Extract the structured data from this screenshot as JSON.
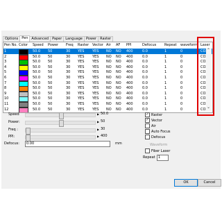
{
  "tabs": [
    "Options",
    "Pen",
    "Advanced",
    "Paper",
    "Language",
    "Power",
    "Raster"
  ],
  "table": {
    "columns": [
      "Pen No.",
      "Color",
      "Speed",
      "Power",
      "Freq",
      "Raster",
      "Vector",
      "Air",
      "AF",
      "PPI",
      "Defocus",
      "Repeat",
      "waveform",
      "Laser"
    ],
    "rows": [
      {
        "pen": "1",
        "color": "#000000",
        "speed": "50.0",
        "power": "50",
        "freq": "30",
        "raster": "YES",
        "vector": "YES",
        "air": "NO",
        "af": "NO",
        "ppi": "400",
        "defocus": "0.0",
        "repeat": "1",
        "waveform": "0",
        "laser": "CO2"
      },
      {
        "pen": "2",
        "color": "#ff0000",
        "speed": "50.0",
        "power": "50",
        "freq": "30",
        "raster": "YES",
        "vector": "YES",
        "air": "NO",
        "af": "NO",
        "ppi": "400",
        "defocus": "0.0",
        "repeat": "1",
        "waveform": "0",
        "laser": "CO2"
      },
      {
        "pen": "3",
        "color": "#00c000",
        "speed": "50.0",
        "power": "50",
        "freq": "30",
        "raster": "YES",
        "vector": "YES",
        "air": "NO",
        "af": "NO",
        "ppi": "400",
        "defocus": "0.0",
        "repeat": "1",
        "waveform": "0",
        "laser": "CO2"
      },
      {
        "pen": "4",
        "color": "#ffff00",
        "speed": "50.0",
        "power": "50",
        "freq": "30",
        "raster": "YES",
        "vector": "YES",
        "air": "NO",
        "af": "NO",
        "ppi": "400",
        "defocus": "0.0",
        "repeat": "1",
        "waveform": "0",
        "laser": "CO2"
      },
      {
        "pen": "5",
        "color": "#0000ff",
        "speed": "50.0",
        "power": "50",
        "freq": "30",
        "raster": "YES",
        "vector": "YES",
        "air": "NO",
        "af": "NO",
        "ppi": "400",
        "defocus": "0.0",
        "repeat": "1",
        "waveform": "0",
        "laser": "CO2"
      },
      {
        "pen": "6",
        "color": "#ff00ff",
        "speed": "50.0",
        "power": "50",
        "freq": "30",
        "raster": "YES",
        "vector": "YES",
        "air": "NO",
        "af": "NO",
        "ppi": "400",
        "defocus": "0.0",
        "repeat": "1",
        "waveform": "0",
        "laser": "CO2"
      },
      {
        "pen": "7",
        "color": "#00ffff",
        "speed": "50.0",
        "power": "50",
        "freq": "30",
        "raster": "YES",
        "vector": "YES",
        "air": "NO",
        "af": "NO",
        "ppi": "400",
        "defocus": "0.0",
        "repeat": "1",
        "waveform": "0",
        "laser": "CO2"
      },
      {
        "pen": "8",
        "color": "#ff8000",
        "speed": "50.0",
        "power": "50",
        "freq": "30",
        "raster": "YES",
        "vector": "YES",
        "air": "NO",
        "af": "NO",
        "ppi": "400",
        "defocus": "0.0",
        "repeat": "1",
        "waveform": "0",
        "laser": "CO2"
      },
      {
        "pen": "9",
        "color": "#c0c0c0",
        "speed": "50.0",
        "power": "50",
        "freq": "30",
        "raster": "YES",
        "vector": "YES",
        "air": "NO",
        "af": "NO",
        "ppi": "400",
        "defocus": "0.0",
        "repeat": "1",
        "waveform": "0",
        "laser": "CO2"
      },
      {
        "pen": "10",
        "color": "#80ffff",
        "speed": "50.0",
        "power": "50",
        "freq": "30",
        "raster": "YES",
        "vector": "YES",
        "air": "NO",
        "af": "NO",
        "ppi": "400",
        "defocus": "0.0",
        "repeat": "1",
        "waveform": "0",
        "laser": "CO2"
      },
      {
        "pen": "11",
        "color": "#808080",
        "speed": "50.0",
        "power": "50",
        "freq": "30",
        "raster": "YES",
        "vector": "YES",
        "air": "NO",
        "af": "NO",
        "ppi": "400",
        "defocus": "0.0",
        "repeat": "1",
        "waveform": "0",
        "laser": "CO2"
      },
      {
        "pen": "12",
        "color": "#ff80c0",
        "speed": "50.0",
        "power": "50",
        "freq": "30",
        "raster": "YES",
        "vector": "YES",
        "air": "NO",
        "af": "NO",
        "ppi": "400",
        "defocus": "0.0",
        "repeat": "1",
        "waveform": "0",
        "laser": "CO2"
      }
    ],
    "selected_row": 0
  },
  "settings": {
    "speed": {
      "label": "Speed",
      "value": "50.0",
      "fraction": 0.5
    },
    "power": {
      "label": "Power:",
      "value": "50",
      "fraction": 0.5
    },
    "freq": {
      "label": "Freq :",
      "value": "30",
      "fraction": 0.0
    },
    "ppi": {
      "label": "PPI:",
      "value": "400",
      "fraction": 0.0
    },
    "defocus": {
      "label": "Defocus:",
      "value": "0.00",
      "unit": "mm"
    }
  },
  "checks": [
    {
      "label": "Raster",
      "checked": true
    },
    {
      "label": "Vector",
      "checked": true
    },
    {
      "label": "Air",
      "checked": false
    },
    {
      "label": "Auto Focus",
      "checked": false
    },
    {
      "label": "Defocus",
      "checked": false
    }
  ],
  "waveform_label": "Waveform",
  "fiber_laser_label": "Fiber Laser",
  "repeat": {
    "label": "Repeat",
    "value": "1"
  },
  "buttons": {
    "ok": "OK",
    "cancel": "Cancel"
  },
  "colors": {
    "selection": "#0078d7",
    "highlight": "#e00000"
  }
}
